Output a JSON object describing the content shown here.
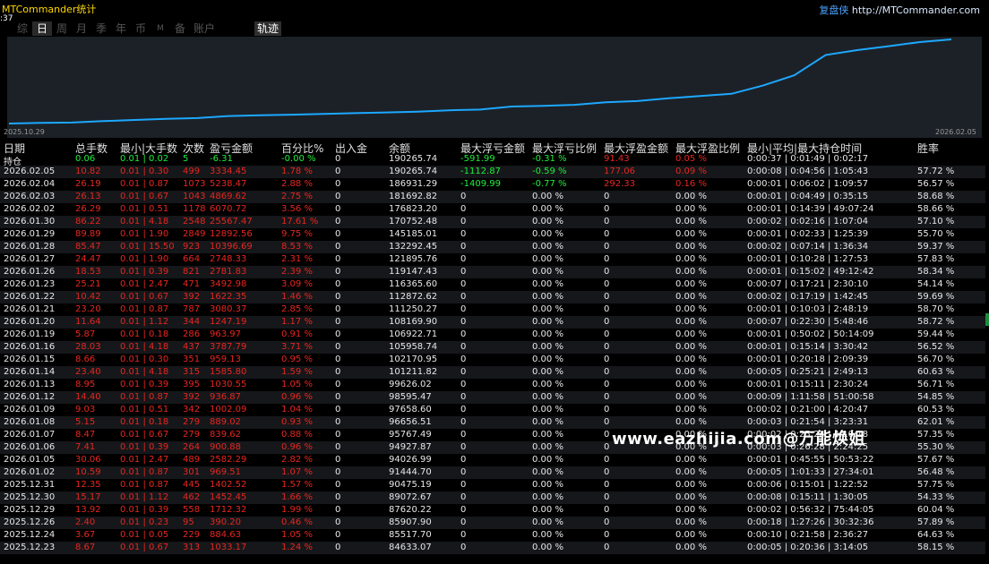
{
  "app": {
    "title": "MTCommander统计",
    "time": ":37",
    "brand_cn": "复盘侠",
    "brand_url": "http://MTCommander.com"
  },
  "tabs": [
    "综",
    "日",
    "周",
    "月",
    "季",
    "年",
    "币",
    "M",
    "备",
    "账户",
    "轨迹"
  ],
  "active_tab": "日",
  "chart_data": {
    "type": "line",
    "x_start_label": "2025.10.29",
    "x_end_label": "2026.02.05",
    "line_color": "#1da8ff",
    "background": "#1c2127",
    "grid": false,
    "y": [
      84633.07,
      85517.7,
      85907.9,
      87620.22,
      89072.67,
      90475.19,
      91444.7,
      94026.99,
      94927.87,
      95767.49,
      96656.51,
      97658.6,
      98595.47,
      99626.02,
      101211.82,
      102170.95,
      105958.74,
      106922.71,
      108169.9,
      111250.27,
      112872.62,
      116365.6,
      119147.43,
      121895.76,
      132292.45,
      145185.01,
      170752.48,
      176823.2,
      181692.82,
      186931.29,
      190265.74
    ]
  },
  "table": {
    "headers": [
      "日期",
      "总手数",
      "最小|大手数",
      "次数",
      "盈亏金额",
      "百分比%",
      "出入金",
      "余额",
      "最大浮亏金额",
      "最大浮亏比例",
      "最大浮盈金额",
      "最大浮盈比例",
      "最小|平均|最大持仓时间",
      "胜率"
    ],
    "position_row": {
      "label": "持仓",
      "lots": "0.06",
      "minmax": "0.01 | 0.02",
      "count": "5",
      "pnl": "-6.31",
      "pct": "-0.00 %",
      "io": "0",
      "balance": "190265.74",
      "max_float_loss": "-591.99",
      "max_float_loss_pct": "-0.31 %",
      "max_float_profit": "91.43",
      "max_float_profit_pct": "0.05 %",
      "hold_time": "0:00:37 | 0:01:49 | 0:02:17",
      "win": ""
    },
    "rows": [
      {
        "date": "2026.02.05",
        "lots": "10.82",
        "minmax": "0.01 | 0.30",
        "count": "499",
        "pnl": "3334.45",
        "pct": "1.78 %",
        "io": "0",
        "balance": "190265.74",
        "mfl": "-1112.87",
        "mflp": "-0.59 %",
        "mfp": "177.06",
        "mfpp": "0.09 %",
        "hold": "0:00:08 | 0:04:56 | 1:05:43",
        "win": "57.72 %"
      },
      {
        "date": "2026.02.04",
        "lots": "26.19",
        "minmax": "0.01 | 0.87",
        "count": "1073",
        "pnl": "5238.47",
        "pct": "2.88 %",
        "io": "0",
        "balance": "186931.29",
        "mfl": "-1409.99",
        "mflp": "-0.77 %",
        "mfp": "292.33",
        "mfpp": "0.16 %",
        "hold": "0:00:01 | 0:06:02 | 1:09:57",
        "win": "56.57 %"
      },
      {
        "date": "2026.02.03",
        "lots": "26.13",
        "minmax": "0.01 | 0.67",
        "count": "1043",
        "pnl": "4869.62",
        "pct": "2.75 %",
        "io": "0",
        "balance": "181692.82",
        "mfl": "0",
        "mflp": "0.00 %",
        "mfp": "0",
        "mfpp": "0.00 %",
        "hold": "0:00:01 | 0:04:49 | 0:35:15",
        "win": "58.68 %"
      },
      {
        "date": "2026.02.02",
        "lots": "26.29",
        "minmax": "0.01 | 0.51",
        "count": "1178",
        "pnl": "6070.72",
        "pct": "3.56 %",
        "io": "0",
        "balance": "176823.20",
        "mfl": "0",
        "mflp": "0.00 %",
        "mfp": "0",
        "mfpp": "0.00 %",
        "hold": "0:00:01 | 0:14:39 | 49:07:24",
        "win": "58.66 %"
      },
      {
        "date": "2026.01.30",
        "lots": "86.22",
        "minmax": "0.01 | 4.18",
        "count": "2548",
        "pnl": "25567.47",
        "pct": "17.61 %",
        "io": "0",
        "balance": "170752.48",
        "mfl": "0",
        "mflp": "0.00 %",
        "mfp": "0",
        "mfpp": "0.00 %",
        "hold": "0:00:02 | 0:02:16 | 1:07:04",
        "win": "57.10 %"
      },
      {
        "date": "2026.01.29",
        "lots": "89.89",
        "minmax": "0.01 | 1.90",
        "count": "2849",
        "pnl": "12892.56",
        "pct": "9.75 %",
        "io": "0",
        "balance": "145185.01",
        "mfl": "0",
        "mflp": "0.00 %",
        "mfp": "0",
        "mfpp": "0.00 %",
        "hold": "0:00:01 | 0:02:33 | 1:25:39",
        "win": "55.70 %"
      },
      {
        "date": "2026.01.28",
        "lots": "85.47",
        "minmax": "0.01 | 15.50",
        "count": "923",
        "pnl": "10396.69",
        "pct": "8.53 %",
        "io": "0",
        "balance": "132292.45",
        "mfl": "0",
        "mflp": "0.00 %",
        "mfp": "0",
        "mfpp": "0.00 %",
        "hold": "0:00:02 | 0:07:14 | 1:36:34",
        "win": "59.37 %"
      },
      {
        "date": "2026.01.27",
        "lots": "24.47",
        "minmax": "0.01 | 1.90",
        "count": "664",
        "pnl": "2748.33",
        "pct": "2.31 %",
        "io": "0",
        "balance": "121895.76",
        "mfl": "0",
        "mflp": "0.00 %",
        "mfp": "0",
        "mfpp": "0.00 %",
        "hold": "0:00:01 | 0:10:28 | 1:27:53",
        "win": "57.83 %"
      },
      {
        "date": "2026.01.26",
        "lots": "18.53",
        "minmax": "0.01 | 0.39",
        "count": "821",
        "pnl": "2781.83",
        "pct": "2.39 %",
        "io": "0",
        "balance": "119147.43",
        "mfl": "0",
        "mflp": "0.00 %",
        "mfp": "0",
        "mfpp": "0.00 %",
        "hold": "0:00:01 | 0:15:02 | 49:12:42",
        "win": "58.34 %"
      },
      {
        "date": "2026.01.23",
        "lots": "25.21",
        "minmax": "0.01 | 2.47",
        "count": "471",
        "pnl": "3492.98",
        "pct": "3.09 %",
        "io": "0",
        "balance": "116365.60",
        "mfl": "0",
        "mflp": "0.00 %",
        "mfp": "0",
        "mfpp": "0.00 %",
        "hold": "0:00:07 | 0:17:21 | 2:30:10",
        "win": "54.14 %"
      },
      {
        "date": "2026.01.22",
        "lots": "10.42",
        "minmax": "0.01 | 0.67",
        "count": "392",
        "pnl": "1622.35",
        "pct": "1.46 %",
        "io": "0",
        "balance": "112872.62",
        "mfl": "0",
        "mflp": "0.00 %",
        "mfp": "0",
        "mfpp": "0.00 %",
        "hold": "0:00:02 | 0:17:19 | 1:42:45",
        "win": "59.69 %"
      },
      {
        "date": "2026.01.21",
        "lots": "23.20",
        "minmax": "0.01 | 0.87",
        "count": "787",
        "pnl": "3080.37",
        "pct": "2.85 %",
        "io": "0",
        "balance": "111250.27",
        "mfl": "0",
        "mflp": "0.00 %",
        "mfp": "0",
        "mfpp": "0.00 %",
        "hold": "0:00:01 | 0:10:03 | 2:48:19",
        "win": "58.70 %"
      },
      {
        "date": "2026.01.20",
        "lots": "11.64",
        "minmax": "0.01 | 1.12",
        "count": "344",
        "pnl": "1247.19",
        "pct": "1.17 %",
        "io": "0",
        "balance": "108169.90",
        "mfl": "0",
        "mflp": "0.00 %",
        "mfp": "0",
        "mfpp": "0.00 %",
        "hold": "0:00:07 | 0:22:30 | 5:48:46",
        "win": "58.72 %"
      },
      {
        "date": "2026.01.19",
        "lots": "5.87",
        "minmax": "0.01 | 0.18",
        "count": "286",
        "pnl": "963.97",
        "pct": "0.91 %",
        "io": "0",
        "balance": "106922.71",
        "mfl": "0",
        "mflp": "0.00 %",
        "mfp": "0",
        "mfpp": "0.00 %",
        "hold": "0:00:01 | 0:50:02 | 50:14:09",
        "win": "59.44 %"
      },
      {
        "date": "2026.01.16",
        "lots": "28.03",
        "minmax": "0.01 | 4.18",
        "count": "437",
        "pnl": "3787.79",
        "pct": "3.71 %",
        "io": "0",
        "balance": "105958.74",
        "mfl": "0",
        "mflp": "0.00 %",
        "mfp": "0",
        "mfpp": "0.00 %",
        "hold": "0:00:01 | 0:15:14 | 3:30:42",
        "win": "56.52 %"
      },
      {
        "date": "2026.01.15",
        "lots": "8.66",
        "minmax": "0.01 | 0.30",
        "count": "351",
        "pnl": "959.13",
        "pct": "0.95 %",
        "io": "0",
        "balance": "102170.95",
        "mfl": "0",
        "mflp": "0.00 %",
        "mfp": "0",
        "mfpp": "0.00 %",
        "hold": "0:00:01 | 0:20:18 | 2:09:39",
        "win": "56.70 %"
      },
      {
        "date": "2026.01.14",
        "lots": "23.40",
        "minmax": "0.01 | 4.18",
        "count": "315",
        "pnl": "1585.80",
        "pct": "1.59 %",
        "io": "0",
        "balance": "101211.82",
        "mfl": "0",
        "mflp": "0.00 %",
        "mfp": "0",
        "mfpp": "0.00 %",
        "hold": "0:00:05 | 0:25:21 | 2:49:13",
        "win": "60.63 %"
      },
      {
        "date": "2026.01.13",
        "lots": "8.95",
        "minmax": "0.01 | 0.39",
        "count": "395",
        "pnl": "1030.55",
        "pct": "1.05 %",
        "io": "0",
        "balance": "99626.02",
        "mfl": "0",
        "mflp": "0.00 %",
        "mfp": "0",
        "mfpp": "0.00 %",
        "hold": "0:00:01 | 0:15:11 | 2:30:24",
        "win": "56.71 %"
      },
      {
        "date": "2026.01.12",
        "lots": "14.40",
        "minmax": "0.01 | 0.87",
        "count": "392",
        "pnl": "936.87",
        "pct": "0.96 %",
        "io": "0",
        "balance": "98595.47",
        "mfl": "0",
        "mflp": "0.00 %",
        "mfp": "0",
        "mfpp": "0.00 %",
        "hold": "0:00:09 | 1:11:58 | 51:00:58",
        "win": "54.85 %"
      },
      {
        "date": "2026.01.09",
        "lots": "9.03",
        "minmax": "0.01 | 0.51",
        "count": "342",
        "pnl": "1002.09",
        "pct": "1.04 %",
        "io": "0",
        "balance": "97658.60",
        "mfl": "0",
        "mflp": "0.00 %",
        "mfp": "0",
        "mfpp": "0.00 %",
        "hold": "0:00:02 | 0:21:00 | 4:20:47",
        "win": "60.53 %"
      },
      {
        "date": "2026.01.08",
        "lots": "5.15",
        "minmax": "0.01 | 0.18",
        "count": "279",
        "pnl": "889.02",
        "pct": "0.93 %",
        "io": "0",
        "balance": "96656.51",
        "mfl": "0",
        "mflp": "0.00 %",
        "mfp": "0",
        "mfpp": "0.00 %",
        "hold": "0:00:03 | 0:21:54 | 3:23:31",
        "win": "62.01 %"
      },
      {
        "date": "2026.01.07",
        "lots": "8.47",
        "minmax": "0.01 | 0.67",
        "count": "279",
        "pnl": "839.62",
        "pct": "0.88 %",
        "io": "0",
        "balance": "95767.49",
        "mfl": "0",
        "mflp": "0.00 %",
        "mfp": "0",
        "mfpp": "0.00 %",
        "hold": "0:00:02 | 0:25:24 | 4:10:18",
        "win": "57.35 %"
      },
      {
        "date": "2026.01.06",
        "lots": "7.41",
        "minmax": "0.01 | 0.39",
        "count": "264",
        "pnl": "900.88",
        "pct": "0.96 %",
        "io": "0",
        "balance": "94927.87",
        "mfl": "0",
        "mflp": "0.00 %",
        "mfp": "0",
        "mfpp": "0.00 %",
        "hold": "0:00:03 | 0:26:28 | 2:24:25",
        "win": "55.30 %"
      },
      {
        "date": "2026.01.05",
        "lots": "30.06",
        "minmax": "0.01 | 2.47",
        "count": "489",
        "pnl": "2582.29",
        "pct": "2.82 %",
        "io": "0",
        "balance": "94026.99",
        "mfl": "0",
        "mflp": "0.00 %",
        "mfp": "0",
        "mfpp": "0.00 %",
        "hold": "0:00:01 | 0:45:55 | 50:53:22",
        "win": "57.67 %"
      },
      {
        "date": "2026.01.02",
        "lots": "10.59",
        "minmax": "0.01 | 0.87",
        "count": "301",
        "pnl": "969.51",
        "pct": "1.07 %",
        "io": "0",
        "balance": "91444.70",
        "mfl": "0",
        "mflp": "0.00 %",
        "mfp": "0",
        "mfpp": "0.00 %",
        "hold": "0:00:05 | 1:01:33 | 27:34:01",
        "win": "56.48 %"
      },
      {
        "date": "2025.12.31",
        "lots": "12.35",
        "minmax": "0.01 | 0.87",
        "count": "445",
        "pnl": "1402.52",
        "pct": "1.57 %",
        "io": "0",
        "balance": "90475.19",
        "mfl": "0",
        "mflp": "0.00 %",
        "mfp": "0",
        "mfpp": "0.00 %",
        "hold": "0:00:06 | 0:15:01 | 1:22:52",
        "win": "57.75 %"
      },
      {
        "date": "2025.12.30",
        "lots": "15.17",
        "minmax": "0.01 | 1.12",
        "count": "462",
        "pnl": "1452.45",
        "pct": "1.66 %",
        "io": "0",
        "balance": "89072.67",
        "mfl": "0",
        "mflp": "0.00 %",
        "mfp": "0",
        "mfpp": "0.00 %",
        "hold": "0:00:08 | 0:15:11 | 1:30:05",
        "win": "54.33 %"
      },
      {
        "date": "2025.12.29",
        "lots": "13.92",
        "minmax": "0.01 | 0.39",
        "count": "558",
        "pnl": "1712.32",
        "pct": "1.99 %",
        "io": "0",
        "balance": "87620.22",
        "mfl": "0",
        "mflp": "0.00 %",
        "mfp": "0",
        "mfpp": "0.00 %",
        "hold": "0:00:02 | 0:56:32 | 75:44:05",
        "win": "60.04 %"
      },
      {
        "date": "2025.12.26",
        "lots": "2.40",
        "minmax": "0.01 | 0.23",
        "count": "95",
        "pnl": "390.20",
        "pct": "0.46 %",
        "io": "0",
        "balance": "85907.90",
        "mfl": "0",
        "mflp": "0.00 %",
        "mfp": "0",
        "mfpp": "0.00 %",
        "hold": "0:00:18 | 1:27:26 | 30:32:36",
        "win": "57.89 %"
      },
      {
        "date": "2025.12.24",
        "lots": "3.67",
        "minmax": "0.01 | 0.05",
        "count": "229",
        "pnl": "884.63",
        "pct": "1.05 %",
        "io": "0",
        "balance": "85517.70",
        "mfl": "0",
        "mflp": "0.00 %",
        "mfp": "0",
        "mfpp": "0.00 %",
        "hold": "0:00:10 | 0:21:58 | 2:36:27",
        "win": "64.63 %"
      },
      {
        "date": "2025.12.23",
        "lots": "8.67",
        "minmax": "0.01 | 0.67",
        "count": "313",
        "pnl": "1033.17",
        "pct": "1.24 %",
        "io": "0",
        "balance": "84633.07",
        "mfl": "0",
        "mflp": "0.00 %",
        "mfp": "0",
        "mfpp": "0.00 %",
        "hold": "0:00:05 | 0:20:36 | 3:14:05",
        "win": "58.15 %"
      }
    ]
  },
  "watermark": "www.eazhijia.com@万能焕姐"
}
